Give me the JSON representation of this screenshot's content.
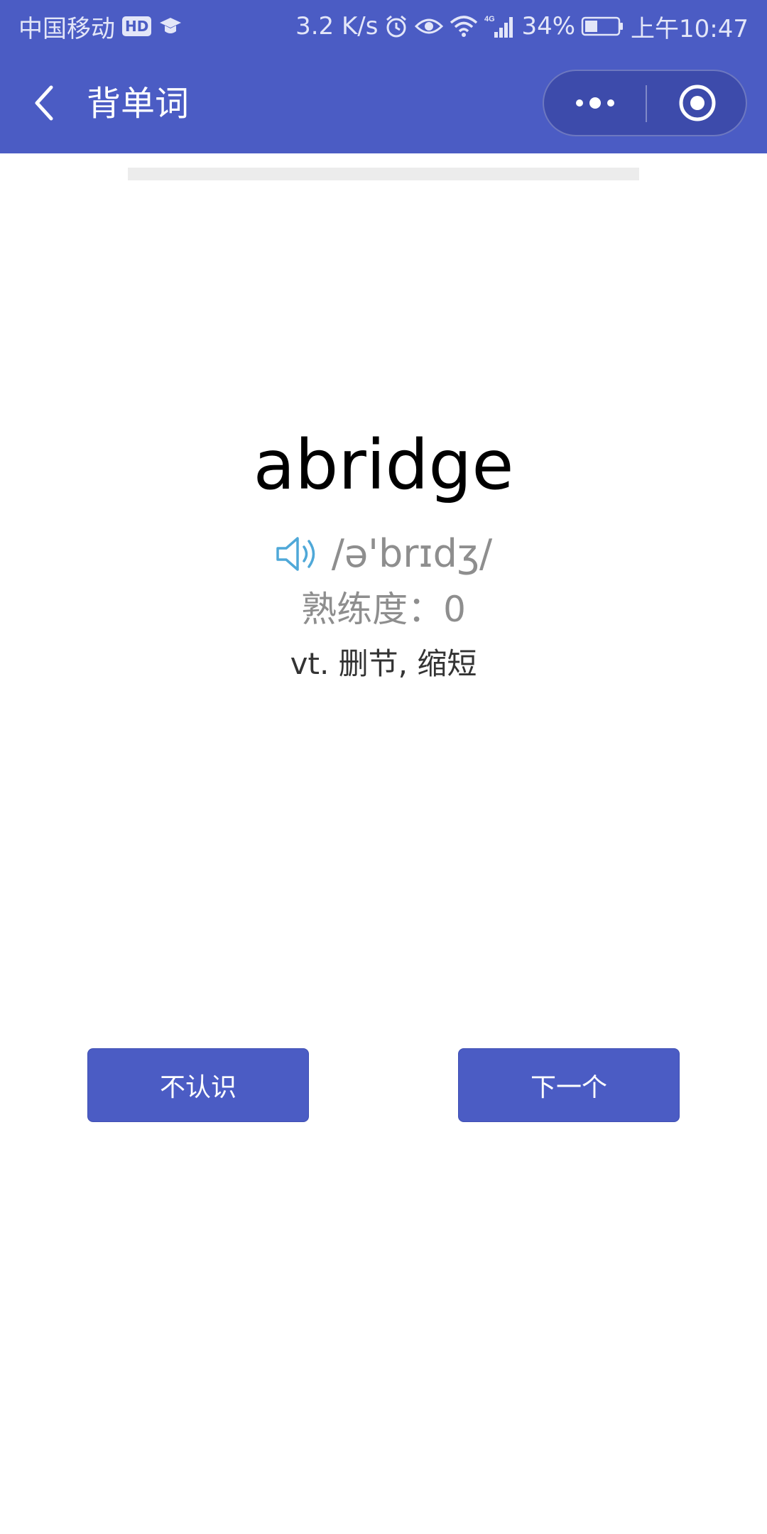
{
  "status_bar": {
    "carrier": "中国移动",
    "hd_badge": "HD",
    "speed": "3.2 K/s",
    "network": "4G",
    "battery": "34%",
    "time": "上午10:47"
  },
  "nav": {
    "title": "背单词"
  },
  "progress": {
    "fraction": 0
  },
  "card": {
    "word": "abridge",
    "phonetic": "/ə'brɪdʒ/",
    "proficiency": "熟练度：0",
    "definition": "vt. 删节, 缩短"
  },
  "actions": {
    "unknown_label": "不认识",
    "next_label": "下一个"
  },
  "colors": {
    "primary": "#4b5cc4",
    "speaker": "#4fa8d8",
    "muted_text": "#8e8e8e"
  }
}
